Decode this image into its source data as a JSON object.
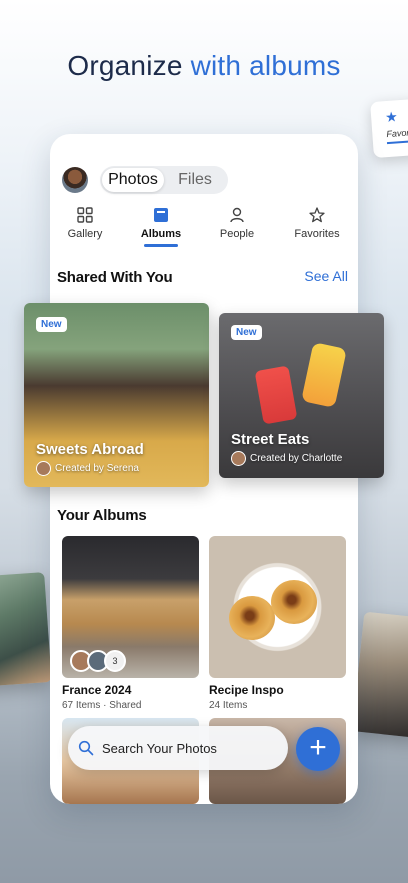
{
  "headline": {
    "prefix": "Organize ",
    "accent": "with albums"
  },
  "deco_card": {
    "label": "Favor"
  },
  "segmented": {
    "photos": "Photos",
    "files": "Files",
    "selected": "Photos"
  },
  "tabs": [
    {
      "label": "Gallery",
      "icon": "grid-icon"
    },
    {
      "label": "Albums",
      "icon": "album-icon",
      "active": true
    },
    {
      "label": "People",
      "icon": "person-icon"
    },
    {
      "label": "Favorites",
      "icon": "star-icon"
    }
  ],
  "shared": {
    "title": "Shared With You",
    "see_all": "See All",
    "cards": [
      {
        "badge": "New",
        "title": "Sweets Abroad",
        "creator": "Created by Serena"
      },
      {
        "badge": "New",
        "title": "Street Eats",
        "creator": "Created by Charlotte"
      }
    ]
  },
  "albums": {
    "title": "Your Albums",
    "items": [
      {
        "name": "France 2024",
        "meta": "67 Items · Shared",
        "extra_members": "3"
      },
      {
        "name": "Recipe Inspo",
        "meta": "24 Items"
      }
    ]
  },
  "search": {
    "placeholder": "Search Your Photos"
  },
  "fab": {
    "label": "+"
  },
  "colors": {
    "accent": "#2f6fd6",
    "headline": "#1d2b4a"
  }
}
